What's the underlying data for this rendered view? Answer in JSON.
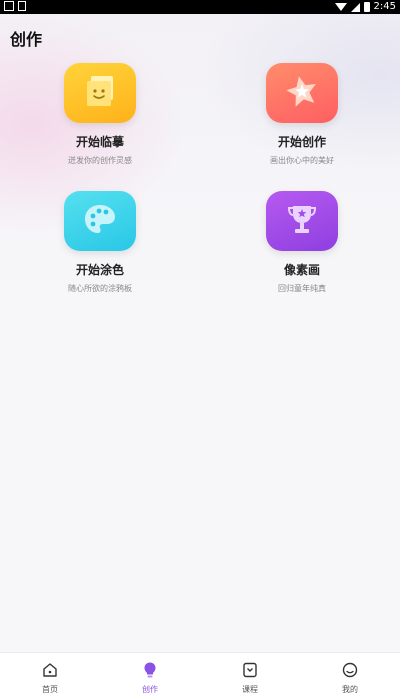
{
  "status_bar": {
    "time": "2:45"
  },
  "page": {
    "title": "创作"
  },
  "cards": [
    {
      "title": "开始临摹",
      "subtitle": "迸发你的创作灵感",
      "icon": "smiley-sticky-note-icon",
      "color": "#ffc52a"
    },
    {
      "title": "开始创作",
      "subtitle": "画出你心中的美好",
      "icon": "star-icon",
      "color": "#ff6f66"
    },
    {
      "title": "开始涂色",
      "subtitle": "随心所欲的涂鸦板",
      "icon": "palette-icon",
      "color": "#3dd3ea"
    },
    {
      "title": "像素画",
      "subtitle": "回归童年纯真",
      "icon": "trophy-icon",
      "color": "#a24de8"
    }
  ],
  "tabbar": {
    "active_color": "#8b52e6",
    "items": [
      {
        "label": "首页",
        "icon": "home-icon",
        "active": false
      },
      {
        "label": "创作",
        "icon": "lightbulb-icon",
        "active": true
      },
      {
        "label": "课程",
        "icon": "course-icon",
        "active": false
      },
      {
        "label": "我的",
        "icon": "profile-face-icon",
        "active": false
      }
    ]
  }
}
